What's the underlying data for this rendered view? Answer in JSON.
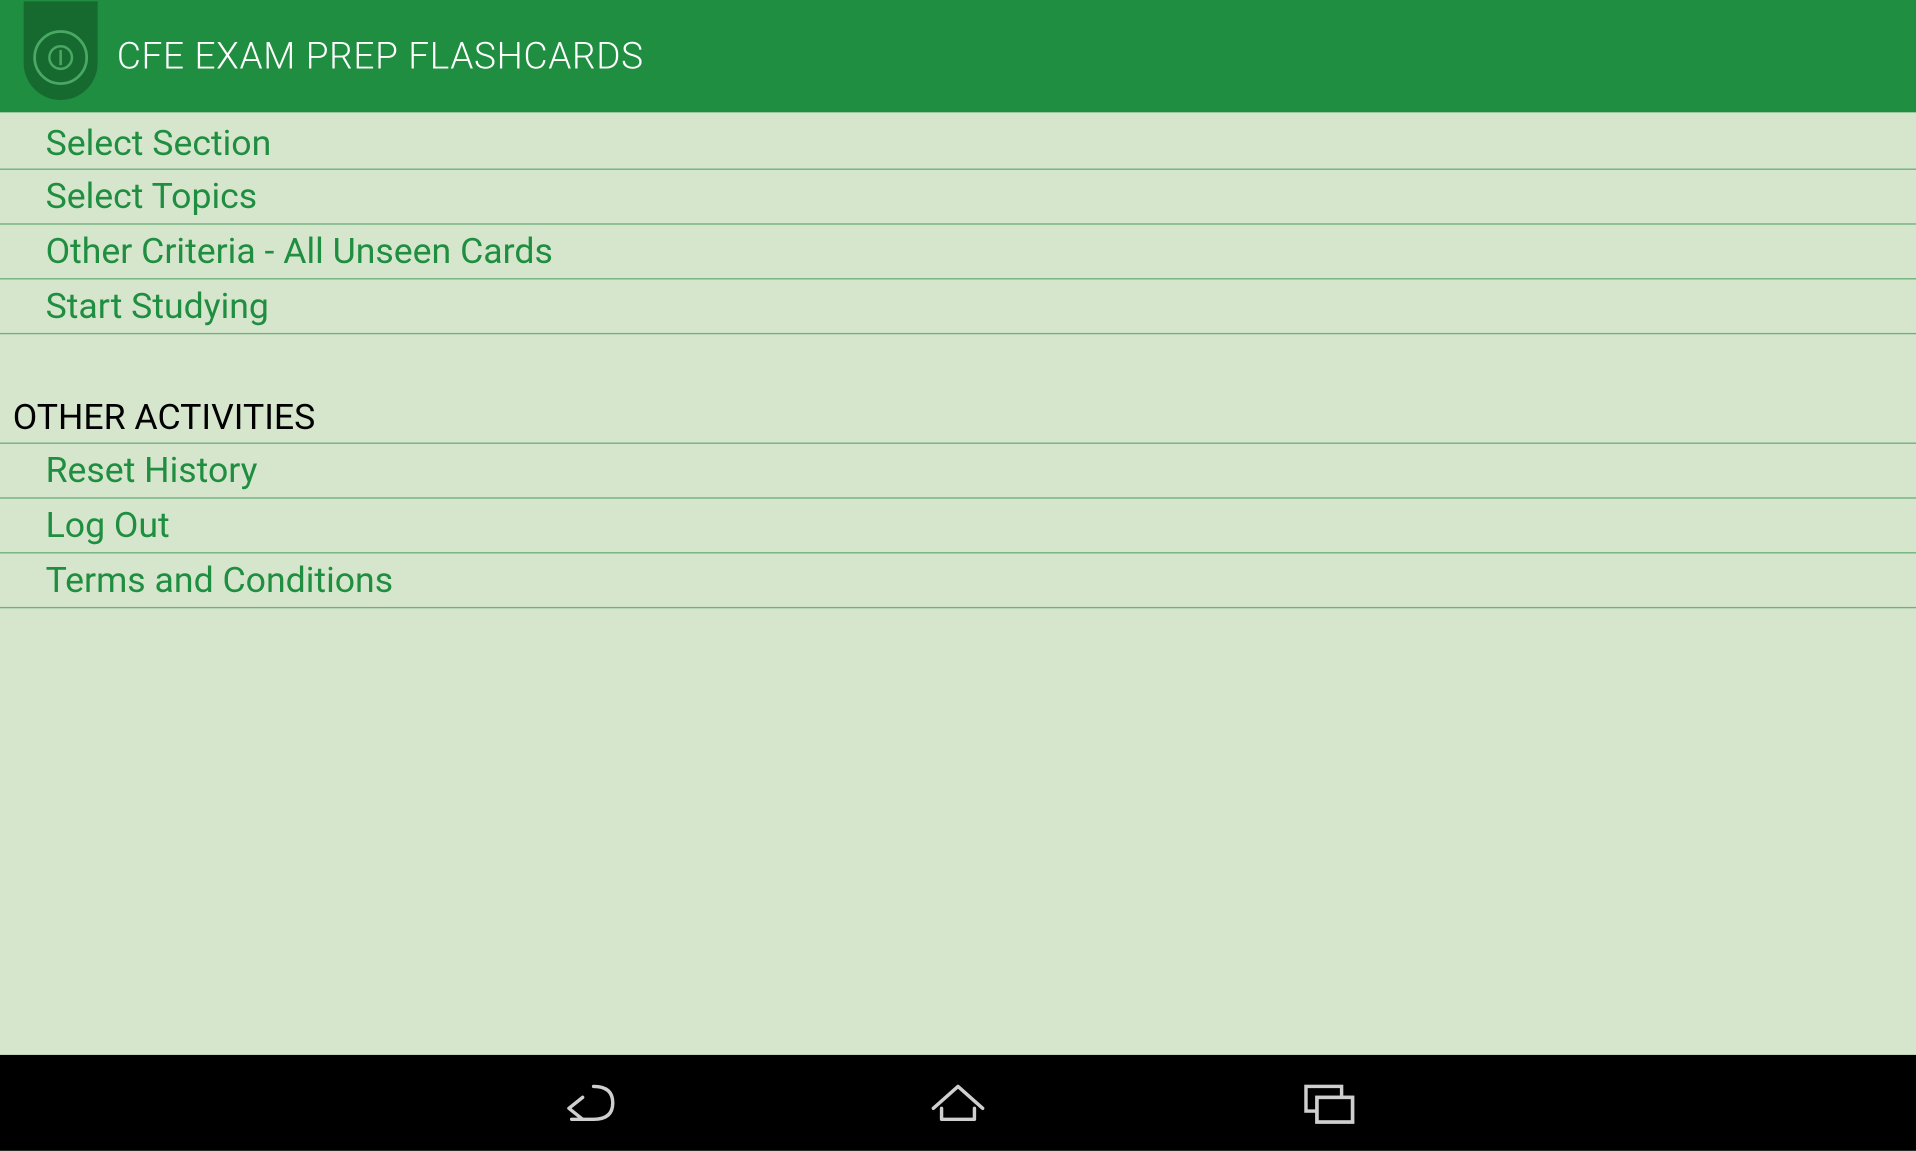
{
  "app": {
    "title": "CFE EXAM PREP FLASHCARDS"
  },
  "main_menu": [
    {
      "label": "Select Section"
    },
    {
      "label": "Select Topics"
    },
    {
      "label": "Other Criteria - All Unseen Cards"
    },
    {
      "label": "Start Studying"
    }
  ],
  "section_header": "OTHER ACTIVITIES",
  "other_menu": [
    {
      "label": "Reset History"
    },
    {
      "label": "Log Out"
    },
    {
      "label": "Terms and Conditions"
    }
  ]
}
